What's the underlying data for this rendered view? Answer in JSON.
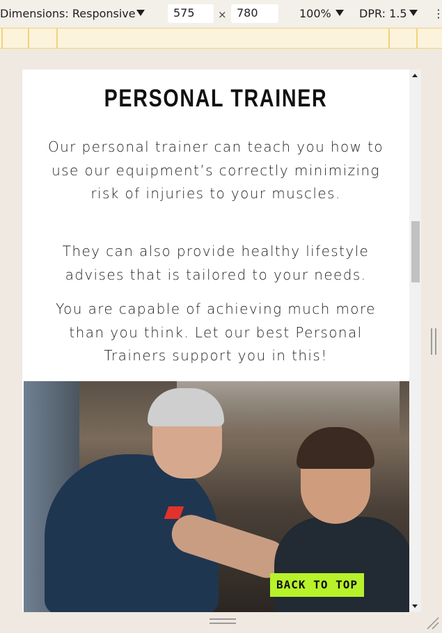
{
  "toolbar": {
    "dimensions_label": "Dimensions: Responsive",
    "width_value": "575",
    "times_symbol": "×",
    "height_value": "780",
    "zoom_label": "100%",
    "dpr_label": "DPR: 1.5"
  },
  "page": {
    "title": "PERSONAL TRAINER",
    "paragraphs": [
      "Our personal trainer can teach you how to use our equipment’s correctly minimizing risk of injuries to your muscles.",
      "They can also provide healthy lifestyle advises that is tailored to your needs.",
      "You are capable of achieving much more than you think. Let our best Personal Trainers support you in this!"
    ],
    "back_to_top_label": "BACK TO TOP",
    "accent_color": "#b7f22a"
  },
  "icons": [
    "dropdown-caret-icon",
    "scroll-up-icon",
    "scroll-down-icon",
    "resize-grip-icon"
  ]
}
